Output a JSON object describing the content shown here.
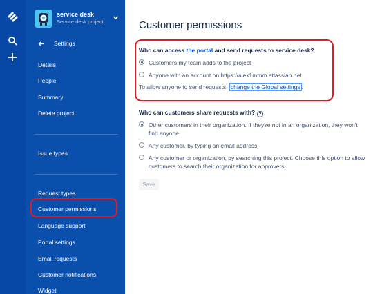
{
  "colors": {
    "rail_bg": "#0747a6",
    "sidebar_bg": "#0b4fad",
    "accent_link": "#0052cc",
    "highlight_annotation": "#e01b24"
  },
  "global_nav": {
    "icons": [
      "jira-logo-icon",
      "search-icon",
      "plus-icon"
    ]
  },
  "project": {
    "name": "service desk",
    "type": "Service desk project"
  },
  "sidebar": {
    "back_label": "Settings",
    "group1": [
      "Details",
      "People",
      "Summary",
      "Delete project"
    ],
    "group2": [
      "Issue types"
    ],
    "group3": [
      "Request types",
      "Customer permissions",
      "Language support",
      "Portal settings",
      "Email requests",
      "Customer notifications",
      "Widget"
    ],
    "active_item": "Customer permissions"
  },
  "main": {
    "title": "Customer permissions",
    "q1": {
      "pre": "Who can access ",
      "link": "the portal",
      "post": " and send requests to service desk?",
      "options": [
        {
          "label": "Customers my team adds to the project",
          "checked": true
        },
        {
          "label": "Anyone with an account on https://alex1mmm.atlassian.net",
          "checked": false
        }
      ],
      "note_pre": "To allow anyone to send requests, ",
      "note_link": "change the Global settings",
      "note_post": "."
    },
    "q2": {
      "heading": "Who can customers share requests with?",
      "help": "?",
      "options": [
        {
          "line1": "Other customers in their organization. If they're not in an organization, they won't",
          "line2": "find anyone.",
          "checked": true
        },
        {
          "line1": "Any customer, by typing an email address.",
          "line2": "",
          "checked": false
        },
        {
          "line1": "Any customer or organization, by searching this project. Choose this option to allow",
          "line2": "customers to search their organization for approvers.",
          "checked": false
        }
      ]
    },
    "save_label": "Save"
  }
}
